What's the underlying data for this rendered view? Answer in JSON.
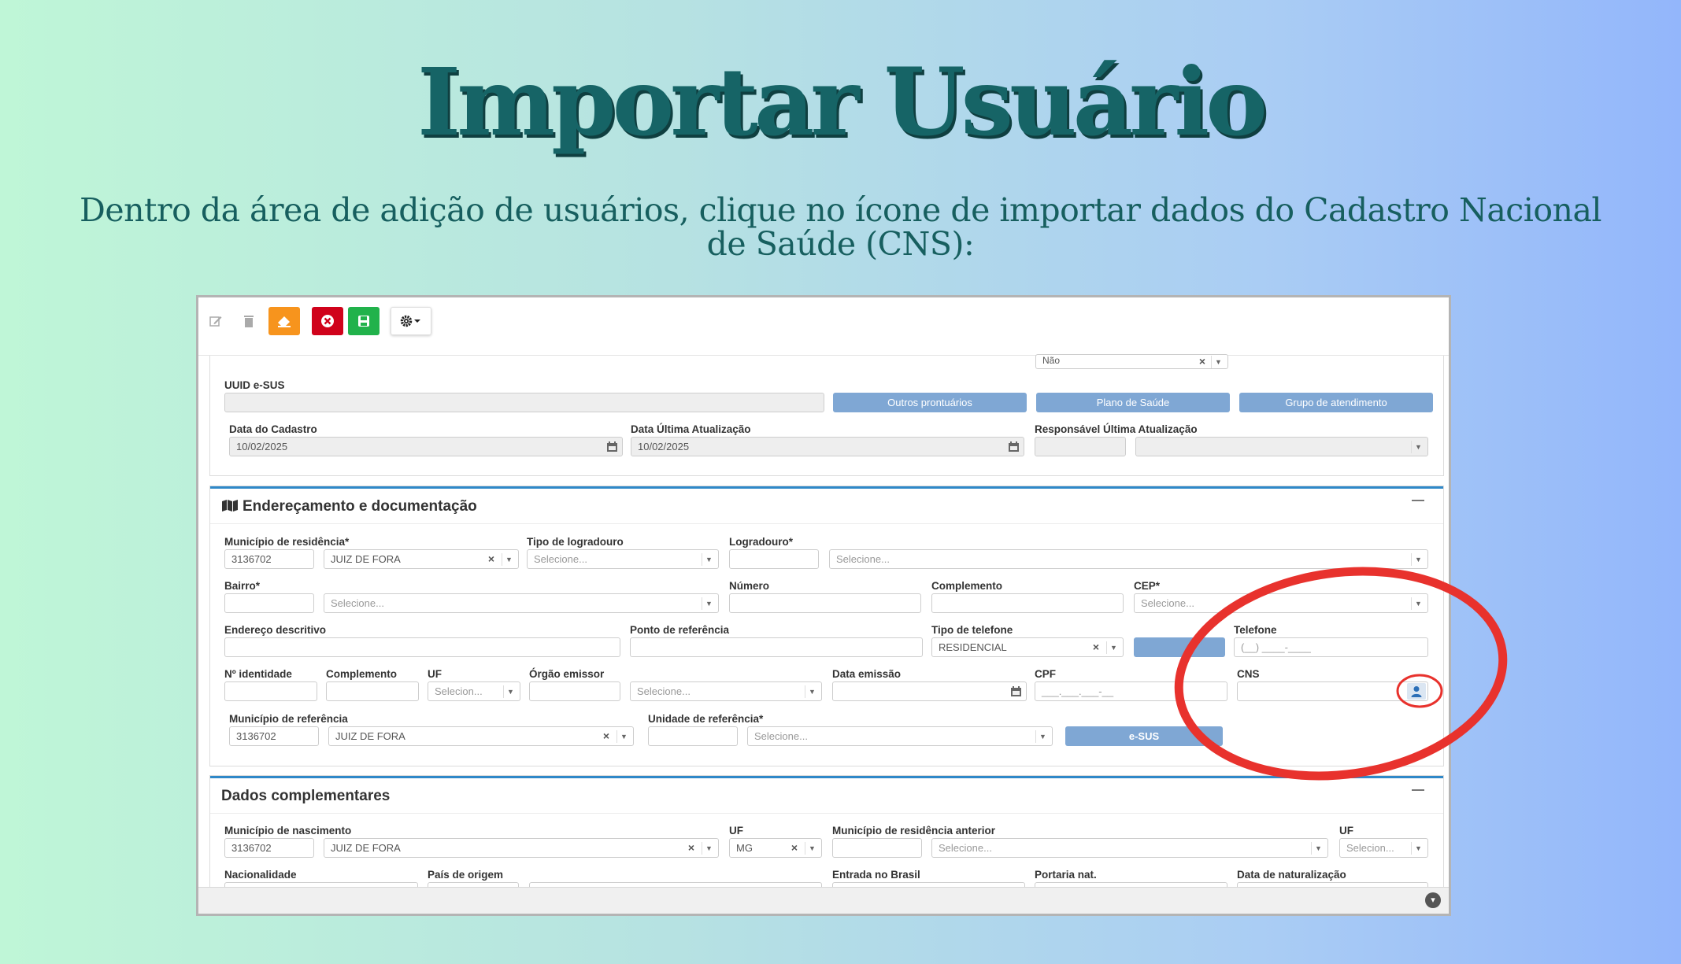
{
  "heading": {
    "title": "Importar Usuário",
    "subtitle": "Dentro da área de adição de usuários, clique no ícone de importar dados do Cadastro Nacional de Saúde (CNS):"
  },
  "toolbar": {
    "buttons": [
      {
        "icon": "edit-icon",
        "color": "#ffffff"
      },
      {
        "icon": "trash-icon",
        "color": "#ffffff"
      },
      {
        "icon": "eraser-icon",
        "color": "#f7941d"
      },
      {
        "icon": "close-circle-icon",
        "color": "#d0021b"
      },
      {
        "icon": "save-icon",
        "color": "#21b24b"
      },
      {
        "icon": "gear-dropdown-icon",
        "color": "#ffffff"
      }
    ]
  },
  "top": {
    "select_value": "Não",
    "uuid_label": "UUID e-SUS",
    "buttons": {
      "outros": "Outros prontuários",
      "plano": "Plano de Saúde",
      "grupo": "Grupo de atendimento"
    },
    "data_cadastro_label": "Data do Cadastro",
    "data_cadastro": "10/02/2025",
    "data_ultima_label": "Data Última Atualização",
    "data_ultima": "10/02/2025",
    "responsavel_label": "Responsável Última Atualização"
  },
  "endereco": {
    "title": "Endereçamento e documentação",
    "municipio_label": "Município de residência*",
    "municipio_code": "3136702",
    "municipio_name": "JUIZ DE FORA",
    "tipo_logradouro_label": "Tipo de logradouro",
    "logradouro_label": "Logradouro*",
    "bairro_label": "Bairro*",
    "numero_label": "Número",
    "complemento_label": "Complemento",
    "cep_label": "CEP*",
    "endereco_desc_label": "Endereço descritivo",
    "ponto_ref_label": "Ponto de referência",
    "tipo_tel_label": "Tipo de telefone",
    "tipo_tel_value": "RESIDENCIAL",
    "telefone_label": "Telefone",
    "telefone_mask": "(__) ____-____",
    "identidade_label": "Nº identidade",
    "complemento2_label": "Complemento",
    "uf_label": "UF",
    "uf_placeholder": "Selecion...",
    "orgao_label": "Órgão emissor",
    "data_emissao_label": "Data emissão",
    "cpf_label": "CPF",
    "cpf_mask": "___.___.___-__",
    "cns_label": "CNS",
    "municipio_ref_label": "Município de referência",
    "municipio_ref_code": "3136702",
    "municipio_ref_name": "JUIZ DE FORA",
    "unidade_ref_label": "Unidade de referência*",
    "esus_button": "e-SUS"
  },
  "complementares": {
    "title": "Dados complementares",
    "nasc_label": "Município de nascimento",
    "nasc_code": "3136702",
    "nasc_name": "JUIZ DE FORA",
    "uf_label": "UF",
    "uf_value": "MG",
    "anterior_label": "Município de residência anterior",
    "uf2_label": "UF",
    "uf2_placeholder": "Selecion...",
    "nacionalidade_label": "Nacionalidade",
    "pais_label": "País de origem",
    "entrada_label": "Entrada no Brasil",
    "portaria_label": "Portaria nat.",
    "data_nat_label": "Data de naturalização"
  },
  "placeholders": {
    "select": "Selecione..."
  },
  "highlight": {
    "color": "#e8322d",
    "target": "cns-import-button"
  }
}
